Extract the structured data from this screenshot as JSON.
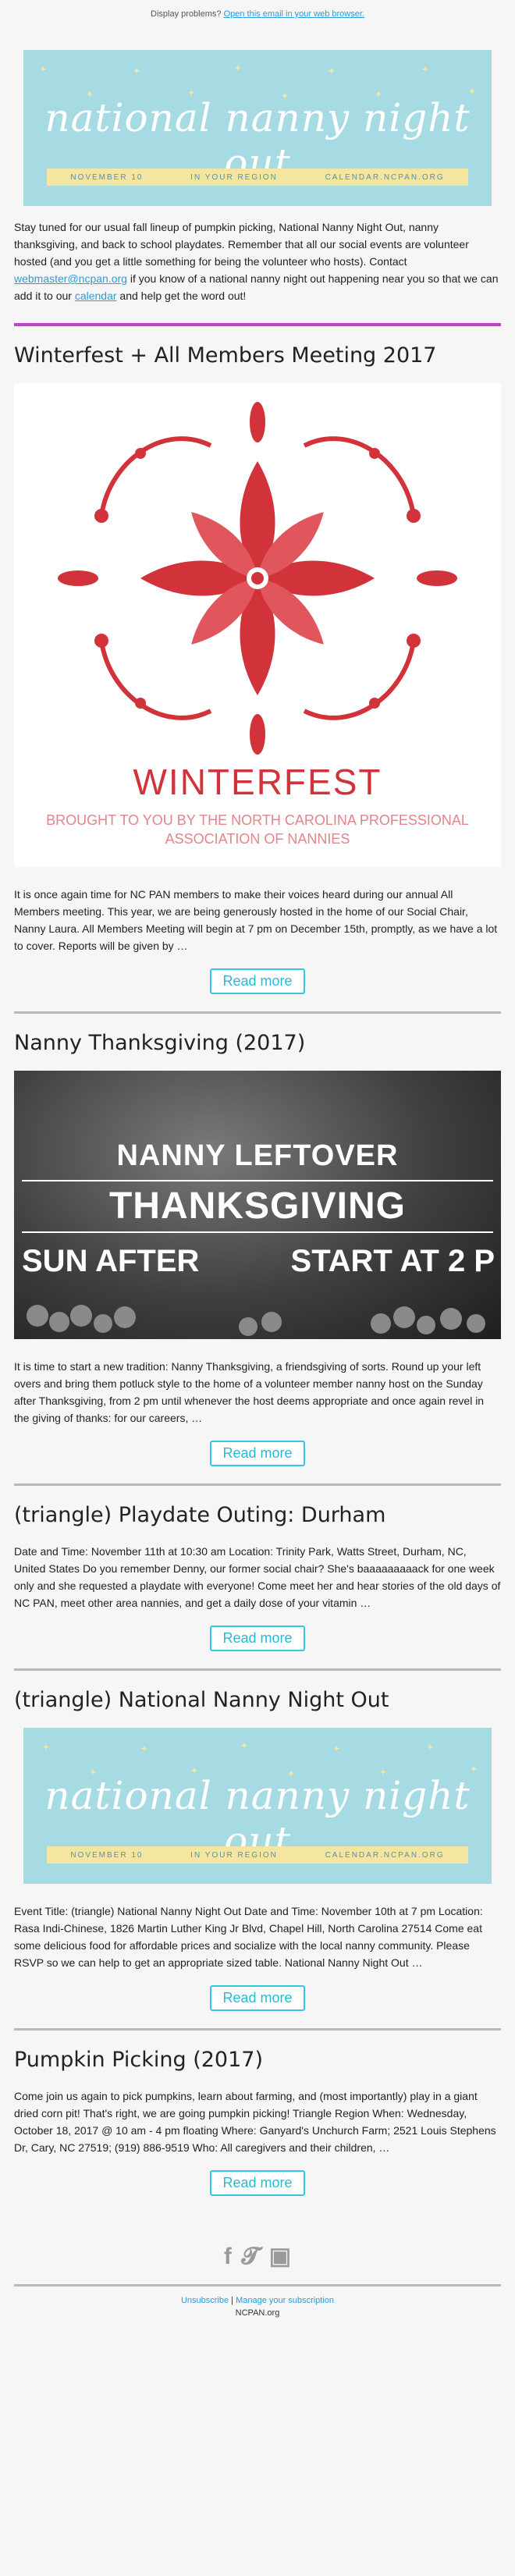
{
  "topbar": {
    "prefix": "Display problems?",
    "link": "Open this email in your web browser."
  },
  "banner": {
    "title": "national nanny night out",
    "strip": [
      "NOVEMBER 10",
      "IN YOUR REGION",
      "CALENDAR.NCPAN.ORG"
    ]
  },
  "intro": {
    "part1": "Stay tuned for our usual fall lineup of pumpkin picking, National Nanny Night Out, nanny thanksgiving, and back to school playdates. Remember that all our social events are volunteer hosted (and you get a little something for being the volunteer who hosts). Contact ",
    "email": "webmaster@ncpan.org",
    "part2": " if you know of a national nanny night out happening near you so that we can add it to our ",
    "calendar": "calendar",
    "part3": " and help get the word out!"
  },
  "posts": [
    {
      "title": "Winterfest + All Members Meeting 2017",
      "image_title": "WINTERFEST",
      "image_subtitle": "BROUGHT TO YOU BY THE NORTH CAROLINA PROFESSIONAL ASSOCIATION OF NANNIES",
      "text": "It is once again time for NC PAN members to make their voices heard during our annual All Members meeting. This year, we are being generously hosted in the home of our Social Chair, Nanny Laura. All Members Meeting will begin at 7 pm on December 15th, promptly, as we have a lot to cover. Reports will be given by …",
      "button": "Read more"
    },
    {
      "title": "Nanny Thanksgiving (2017)",
      "image_lines": [
        "NANNY LEFTOVER",
        "THANKSGIVING",
        "SUN AFTER",
        "START AT 2 P"
      ],
      "text": "It is time to start a new tradition: Nanny Thanksgiving, a friendsgiving of sorts. Round up your left overs and bring them potluck style to the home of a volunteer member nanny host on the Sunday after Thanksgiving, from 2 pm until whenever the host deems appropriate and once again revel in the giving of thanks: for our careers, …",
      "button": "Read more"
    },
    {
      "title": "(triangle) Playdate Outing: Durham",
      "text": "Date and Time: November 11th at 10:30 am Location: Trinity Park, Watts Street, Durham, NC, United States Do you remember Denny, our former social chair? She's baaaaaaaaack for one week only and she requested a playdate with everyone! Come meet her and hear stories of the old days of NC PAN, meet other area nannies, and get a daily dose of your vitamin …",
      "button": "Read more"
    },
    {
      "title": "(triangle) National Nanny Night Out",
      "text": "Event Title: (triangle) National Nanny Night Out Date and Time: November 10th at 7 pm Location: Rasa Indi-Chinese, 1826 Martin Luther King Jr Blvd, Chapel Hill, North Carolina 27514 Come eat some delicious food for affordable prices and socialize with the local nanny community. Please RSVP so we can help to get an appropriate sized table. National Nanny Night Out …",
      "button": "Read more"
    },
    {
      "title": "Pumpkin Picking (2017)",
      "text": "Come join us again to pick pumpkins, learn about farming, and (most importantly) play in a giant dried corn pit! That's right, we are going pumpkin picking! Triangle Region When: Wednesday, October 18, 2017 @ 10 am - 4 pm floating Where: Ganyard's Unchurch Farm; 2521 Louis Stephens Dr, Cary, NC 27519; (919) 886-9519 Who: All caregivers and their children, …",
      "button": "Read more"
    }
  ],
  "footer": {
    "social_icons": [
      "facebook-icon",
      "twitter-icon",
      "instagram-icon"
    ],
    "unsubscribe": "Unsubscribe",
    "separator": " | ",
    "manage": "Manage your subscription",
    "org": "NCPAN.org"
  },
  "colors": {
    "accent": "#c43fcf",
    "link": "#2b9cd8",
    "button": "#35c7e0",
    "banner_bg": "#a7dbe4",
    "banner_strip": "#f4e6a0",
    "winter_red": "#d2333a"
  }
}
